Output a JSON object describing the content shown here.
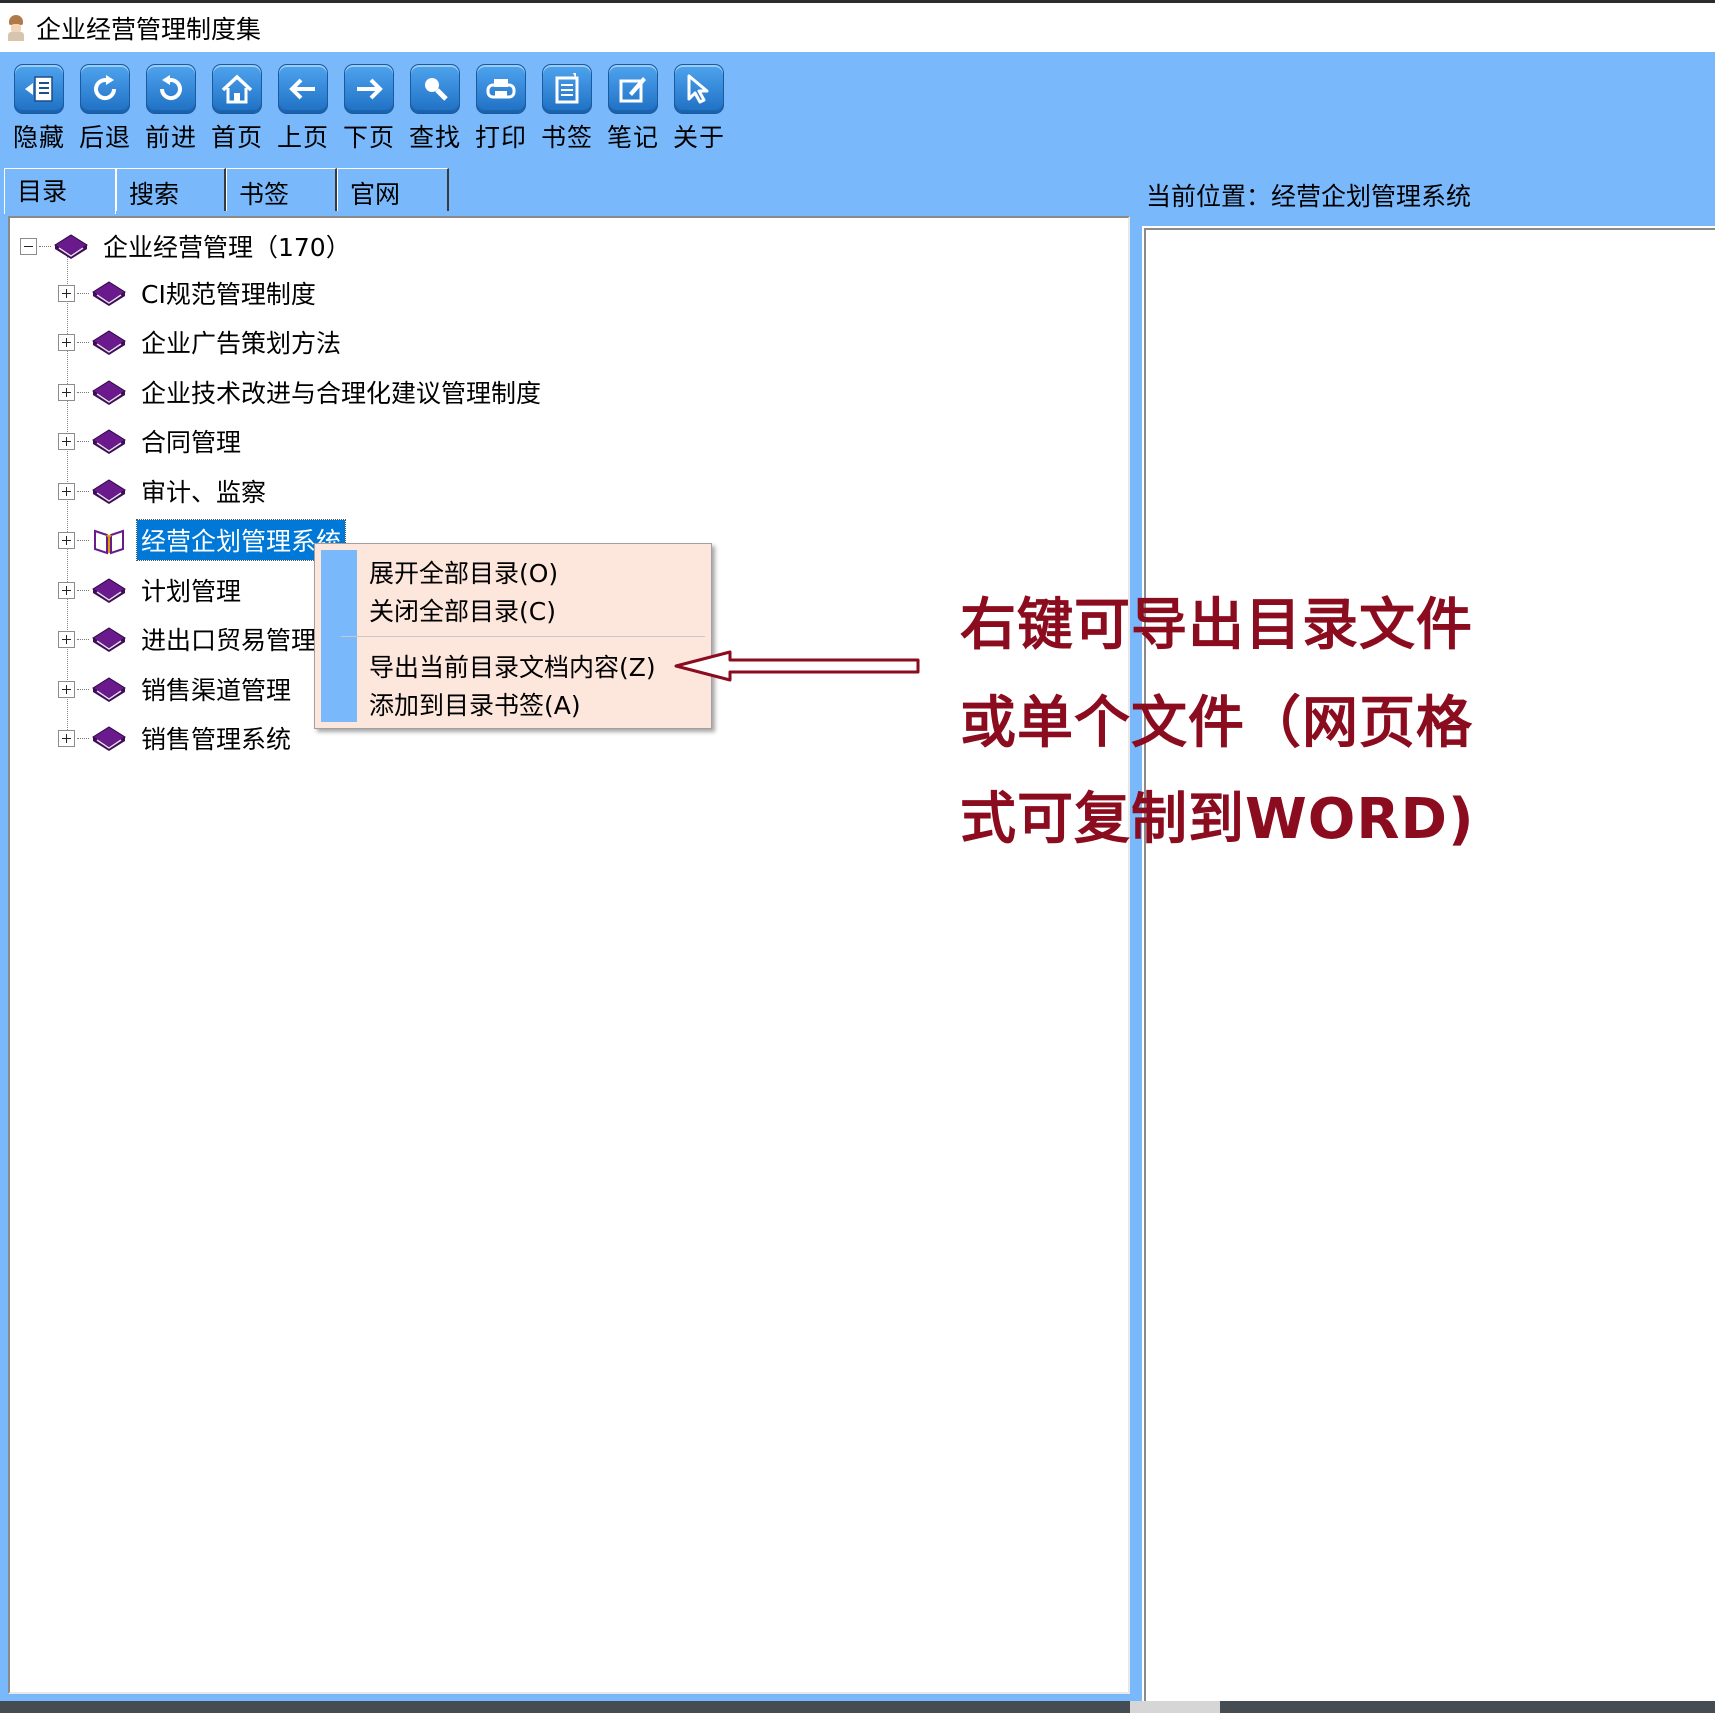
{
  "window": {
    "title": "企业经营管理制度集"
  },
  "toolbar": {
    "buttons": [
      {
        "label": "隐藏",
        "icon": "hide-icon"
      },
      {
        "label": "后退",
        "icon": "back-refresh-icon"
      },
      {
        "label": "前进",
        "icon": "forward-refresh-icon"
      },
      {
        "label": "首页",
        "icon": "home-icon"
      },
      {
        "label": "上页",
        "icon": "arrow-left-icon"
      },
      {
        "label": "下页",
        "icon": "arrow-right-icon"
      },
      {
        "label": "查找",
        "icon": "magnifier-icon"
      },
      {
        "label": "打印",
        "icon": "printer-icon"
      },
      {
        "label": "书签",
        "icon": "bookmark-page-icon"
      },
      {
        "label": "笔记",
        "icon": "note-icon"
      },
      {
        "label": "关于",
        "icon": "cursor-icon"
      }
    ]
  },
  "tabs": [
    {
      "label": "目录",
      "active": true
    },
    {
      "label": "搜索",
      "active": false
    },
    {
      "label": "书签",
      "active": false
    },
    {
      "label": "官网",
      "active": false
    }
  ],
  "tree": {
    "root": {
      "label": "企业经营管理（170）",
      "expanded": true
    },
    "children": [
      {
        "label": "CI规范管理制度",
        "selected": false
      },
      {
        "label": "企业广告策划方法",
        "selected": false
      },
      {
        "label": "企业技术改进与合理化建议管理制度",
        "selected": false
      },
      {
        "label": "合同管理",
        "selected": false
      },
      {
        "label": "审计、监察",
        "selected": false
      },
      {
        "label": "经营企划管理系统",
        "selected": true
      },
      {
        "label": "计划管理",
        "selected": false
      },
      {
        "label": "进出口贸易管理系",
        "selected": false
      },
      {
        "label": "销售渠道管理",
        "selected": false
      },
      {
        "label": "销售管理系统",
        "selected": false
      }
    ]
  },
  "context_menu": {
    "items": [
      {
        "label": "展开全部目录(O)"
      },
      {
        "label": "关闭全部目录(C)"
      },
      {
        "label": "导出当前目录文档内容(Z)"
      },
      {
        "label": "添加到目录书签(A)"
      }
    ]
  },
  "right_pane": {
    "location": "当前位置：经营企划管理系统"
  },
  "annotation": {
    "lines": [
      "右键可导出目录文件",
      "或单个文件（网页格",
      "式可复制到WORD)"
    ],
    "color": "#8b0b1f"
  },
  "colors": {
    "toolbar_bg": "#79b9fb",
    "selection": "#0078d7",
    "book": "#6a1a8c",
    "menu_bg": "#fde6dc"
  }
}
